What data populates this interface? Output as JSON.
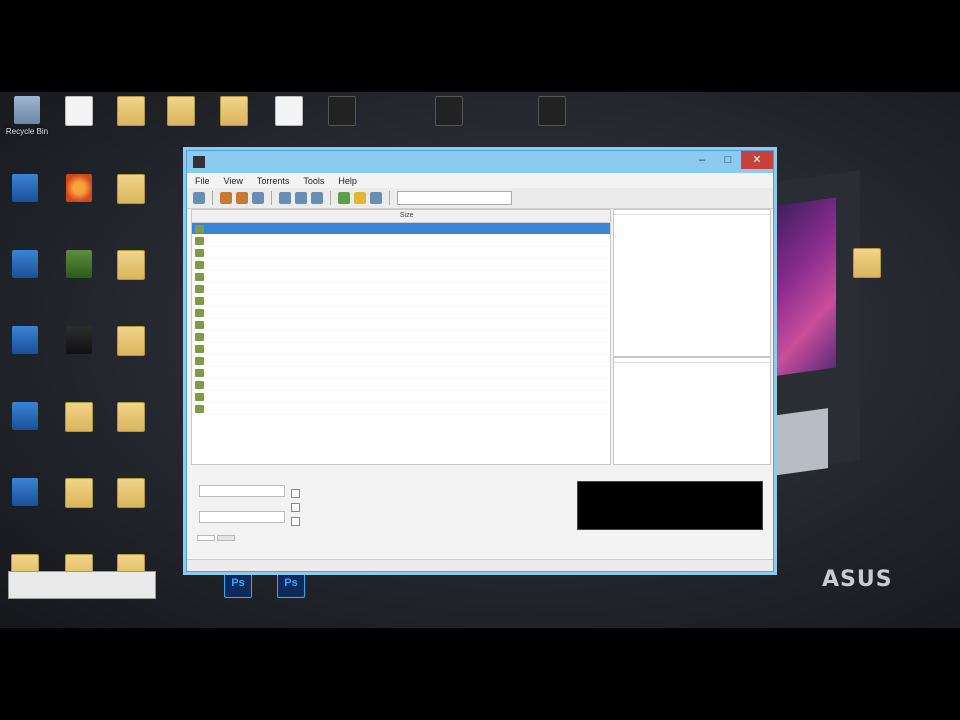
{
  "desktop": {
    "brand": "ASUS",
    "icons": [
      {
        "label": "Recycle Bin",
        "icon": "recycle-bin-icon"
      },
      {
        "label": "",
        "icon": "document-icon"
      },
      {
        "label": "",
        "icon": "folder-icon"
      },
      {
        "label": "",
        "icon": "folder-icon"
      },
      {
        "label": "",
        "icon": "folder-icon"
      },
      {
        "label": "",
        "icon": "document-icon"
      },
      {
        "label": "",
        "icon": "window-icon"
      },
      {
        "label": "",
        "icon": "window-icon"
      },
      {
        "label": "",
        "icon": "window-icon"
      },
      {
        "label": "",
        "icon": "app-icon"
      },
      {
        "label": "",
        "icon": "firefox-icon"
      },
      {
        "label": "",
        "icon": "folder-icon"
      },
      {
        "label": "",
        "icon": "app-icon"
      },
      {
        "label": "",
        "icon": "app-icon"
      },
      {
        "label": "",
        "icon": "folder-icon"
      },
      {
        "label": "",
        "icon": "app-icon"
      },
      {
        "label": "",
        "icon": "app-icon"
      },
      {
        "label": "",
        "icon": "folder-icon"
      },
      {
        "label": "",
        "icon": "app-icon"
      },
      {
        "label": "",
        "icon": "folder-icon"
      },
      {
        "label": "",
        "icon": "folder-icon"
      },
      {
        "label": "",
        "icon": "app-icon"
      },
      {
        "label": "",
        "icon": "folder-icon"
      },
      {
        "label": "",
        "icon": "folder-icon"
      },
      {
        "label": "",
        "icon": "folder-icon"
      },
      {
        "label": "",
        "icon": "folder-icon"
      },
      {
        "label": "",
        "icon": "folder-icon"
      },
      {
        "label": "",
        "icon": "photoshop-icon"
      },
      {
        "label": "",
        "icon": "photoshop-icon"
      },
      {
        "label": "",
        "icon": "folder-icon"
      }
    ]
  },
  "window": {
    "title": "",
    "menu": [
      "File",
      "View",
      "Torrents",
      "Tools",
      "Help"
    ],
    "address": "",
    "columns": [
      "",
      "Size",
      "",
      "",
      ""
    ],
    "rows": [
      {
        "name": "",
        "size": "",
        "selected": true
      },
      {
        "name": "",
        "size": "",
        "selected": false
      },
      {
        "name": "",
        "size": "",
        "selected": false
      },
      {
        "name": "",
        "size": "",
        "selected": false
      },
      {
        "name": "",
        "size": "",
        "selected": false
      },
      {
        "name": "",
        "size": "",
        "selected": false
      },
      {
        "name": "",
        "size": "",
        "selected": false
      },
      {
        "name": "",
        "size": "",
        "selected": false
      },
      {
        "name": "",
        "size": "",
        "selected": false
      },
      {
        "name": "",
        "size": "",
        "selected": false
      },
      {
        "name": "",
        "size": "",
        "selected": false
      },
      {
        "name": "",
        "size": "",
        "selected": false
      },
      {
        "name": "",
        "size": "",
        "selected": false
      },
      {
        "name": "",
        "size": "",
        "selected": false
      },
      {
        "name": "",
        "size": "",
        "selected": false
      },
      {
        "name": "",
        "size": "",
        "selected": false
      }
    ],
    "side_top_headers": [
      "",
      ""
    ],
    "side_bottom_headers": [
      "",
      ""
    ],
    "tabs": [
      "",
      ""
    ],
    "status": ""
  }
}
